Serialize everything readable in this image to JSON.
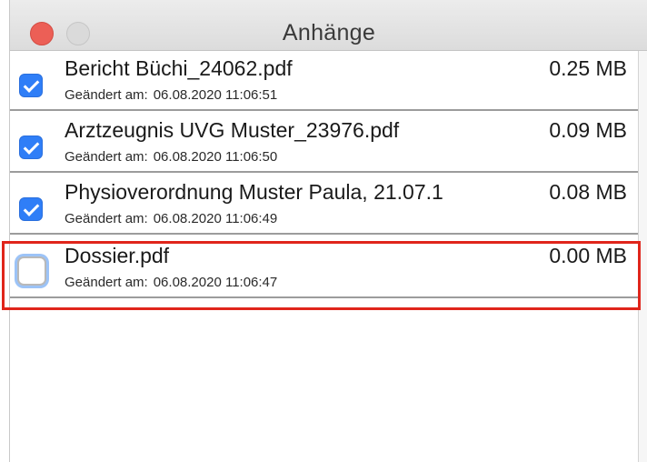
{
  "window": {
    "title": "Anhänge"
  },
  "files": [
    {
      "name": "Bericht Büchi_24062.pdf",
      "size": "0.25 MB",
      "modified_label": "Geändert am:",
      "modified_value": "06.08.2020 11:06:51",
      "checked": true
    },
    {
      "name": "Arztzeugnis UVG Muster_23976.pdf",
      "size": "0.09 MB",
      "modified_label": "Geändert am:",
      "modified_value": "06.08.2020 11:06:50",
      "checked": true
    },
    {
      "name": "Physioverordnung Muster Paula, 21.07.1",
      "size": "0.08 MB",
      "modified_label": "Geändert am:",
      "modified_value": "06.08.2020 11:06:49",
      "checked": true
    },
    {
      "name": "Dossier.pdf",
      "size": "0.00 MB",
      "modified_label": "Geändert am:",
      "modified_value": "06.08.2020 11:06:47",
      "checked": false
    }
  ],
  "colors": {
    "checkbox_checked": "#2f7ef7",
    "highlight": "#e0251b",
    "close_button": "#ec5f56"
  },
  "icons": {
    "close": "close-icon",
    "minimize": "minimize-icon",
    "check": "checkmark-icon"
  }
}
